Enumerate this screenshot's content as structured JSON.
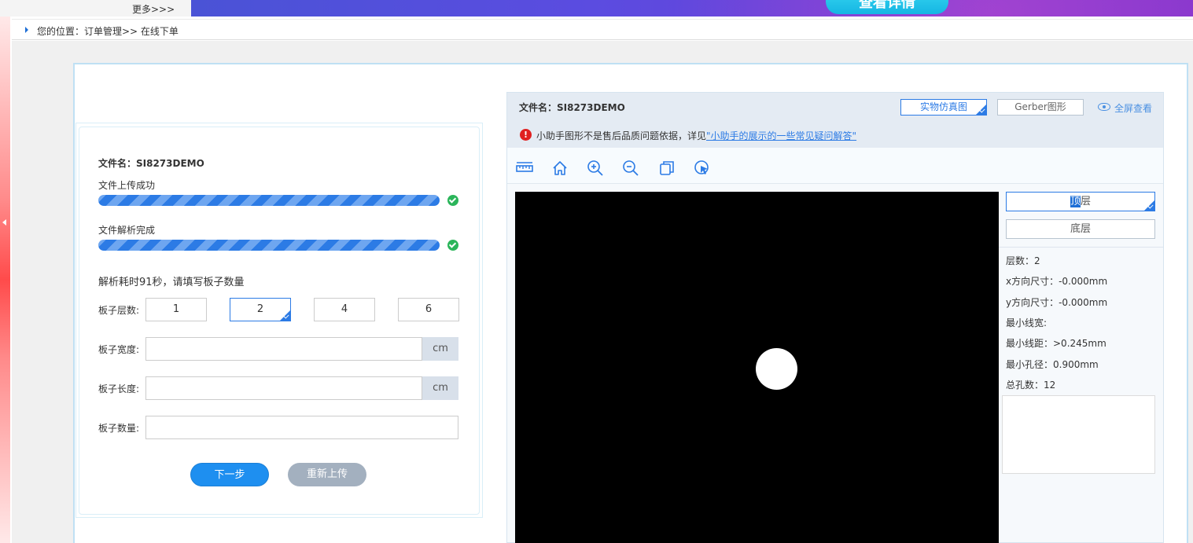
{
  "topbar": {
    "more": "更多>>>",
    "banner_button": "查看详情"
  },
  "breadcrumb": {
    "text": "您的位置：订单管理>> 在线下单"
  },
  "left": {
    "filename": "文件名：SI8273DEMO",
    "upload_label": "文件上传成功",
    "upload_progress": 1.0,
    "parse_label": "文件解析完成",
    "parse_progress": 1.0,
    "parse_note": "解析耗时91秒，请填写板子数量",
    "layers_label": "板子层数:",
    "layer_options": [
      "1",
      "2",
      "4",
      "6"
    ],
    "layer_selected": "2",
    "width_label": "板子宽度:",
    "width_value": "",
    "width_unit": "cm",
    "length_label": "板子长度:",
    "length_value": "",
    "length_unit": "cm",
    "qty_label": "板子数量:",
    "qty_value": "",
    "next_button": "下一步",
    "reupload_button": "重新上传"
  },
  "viewer": {
    "filename": "文件名：SI8273DEMO",
    "tab_real": "实物仿真图",
    "tab_gerber": "Gerber图形",
    "fullscreen": "全屏查看",
    "warning_icon": "!",
    "warning_text": "小助手图形不是售后品质问题依据，详见",
    "warning_link": "\"小助手的展示的一些常见疑问解答\"",
    "tools": [
      "ruler-icon",
      "home-icon",
      "zoom-in-icon",
      "zoom-out-icon",
      "copy-icon",
      "cursor-select-icon"
    ],
    "layer_top_hl": "顶",
    "layer_top_rest": "层",
    "layer_bottom": "底层",
    "stats": {
      "layers": "层数：2",
      "x_size": "x方向尺寸：-0.000mm",
      "y_size": "y方向尺寸：-0.000mm",
      "min_width": "最小线宽:",
      "min_spacing": "最小线距：>0.245mm",
      "min_hole": "最小孔径：0.900mm",
      "total_holes": "总孔数：12"
    }
  },
  "colors": {
    "accent": "#2c7be5",
    "success": "#2bb55a",
    "warning": "#e02020",
    "canvas": "#000000"
  }
}
